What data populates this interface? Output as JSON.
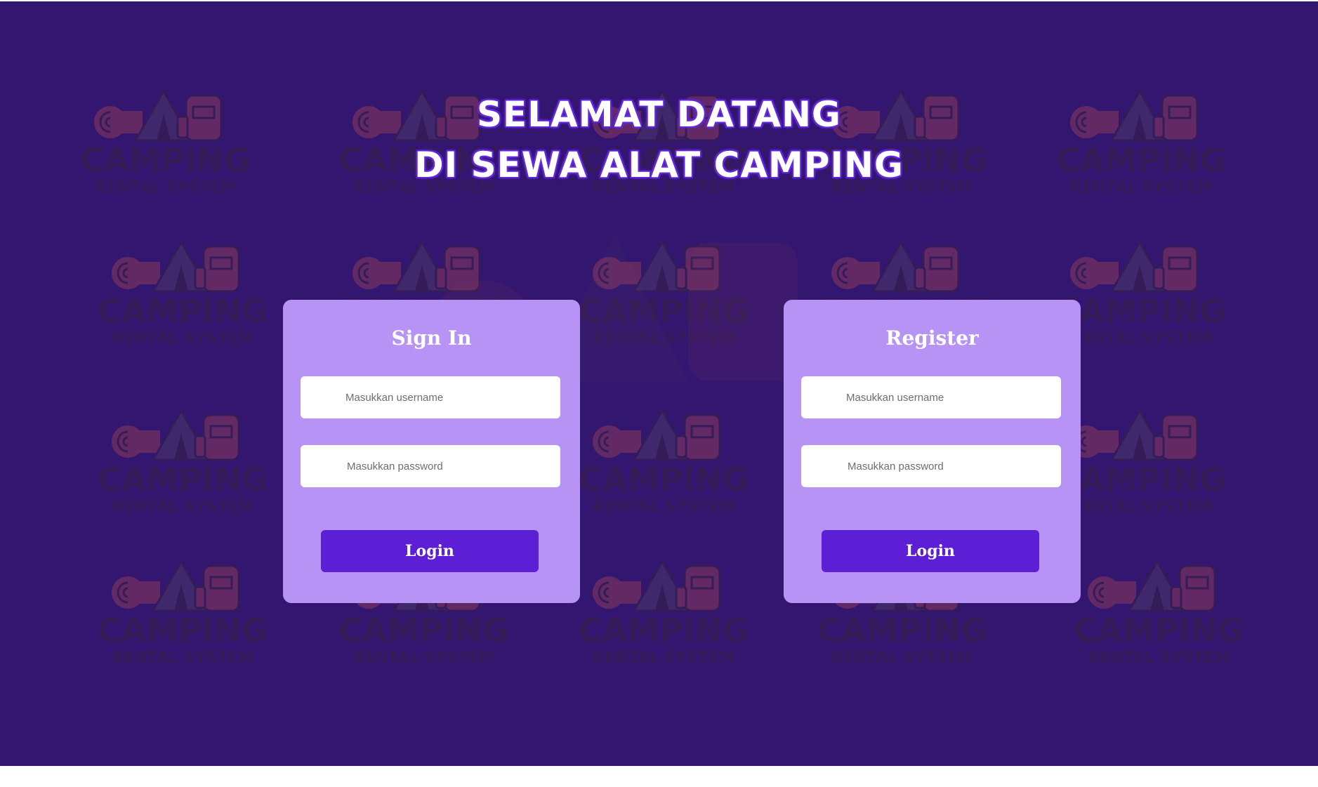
{
  "header": {
    "line1": "SELAMAT DATANG",
    "line2": "DI SEWA ALAT CAMPING"
  },
  "signin": {
    "title": "Sign In",
    "username_placeholder": "Masukkan username",
    "password_placeholder": "Masukkan password",
    "button_label": "Login"
  },
  "register": {
    "title": "Register",
    "username_placeholder": "Masukkan username",
    "password_placeholder": "Masukkan password",
    "button_label": "Login"
  },
  "watermark": {
    "brand": "CAMPING",
    "tagline": "RENTAL SYSTEM",
    "icon": "camping-logo-icon"
  },
  "colors": {
    "background": "#33166f",
    "card": "#b793f5",
    "button": "#5c1fd6",
    "heading_glow": "#5b22d6",
    "logo_tent": "#4a3a6a",
    "logo_bag": "#8a3a5e",
    "logo_text": "#3a2048"
  }
}
